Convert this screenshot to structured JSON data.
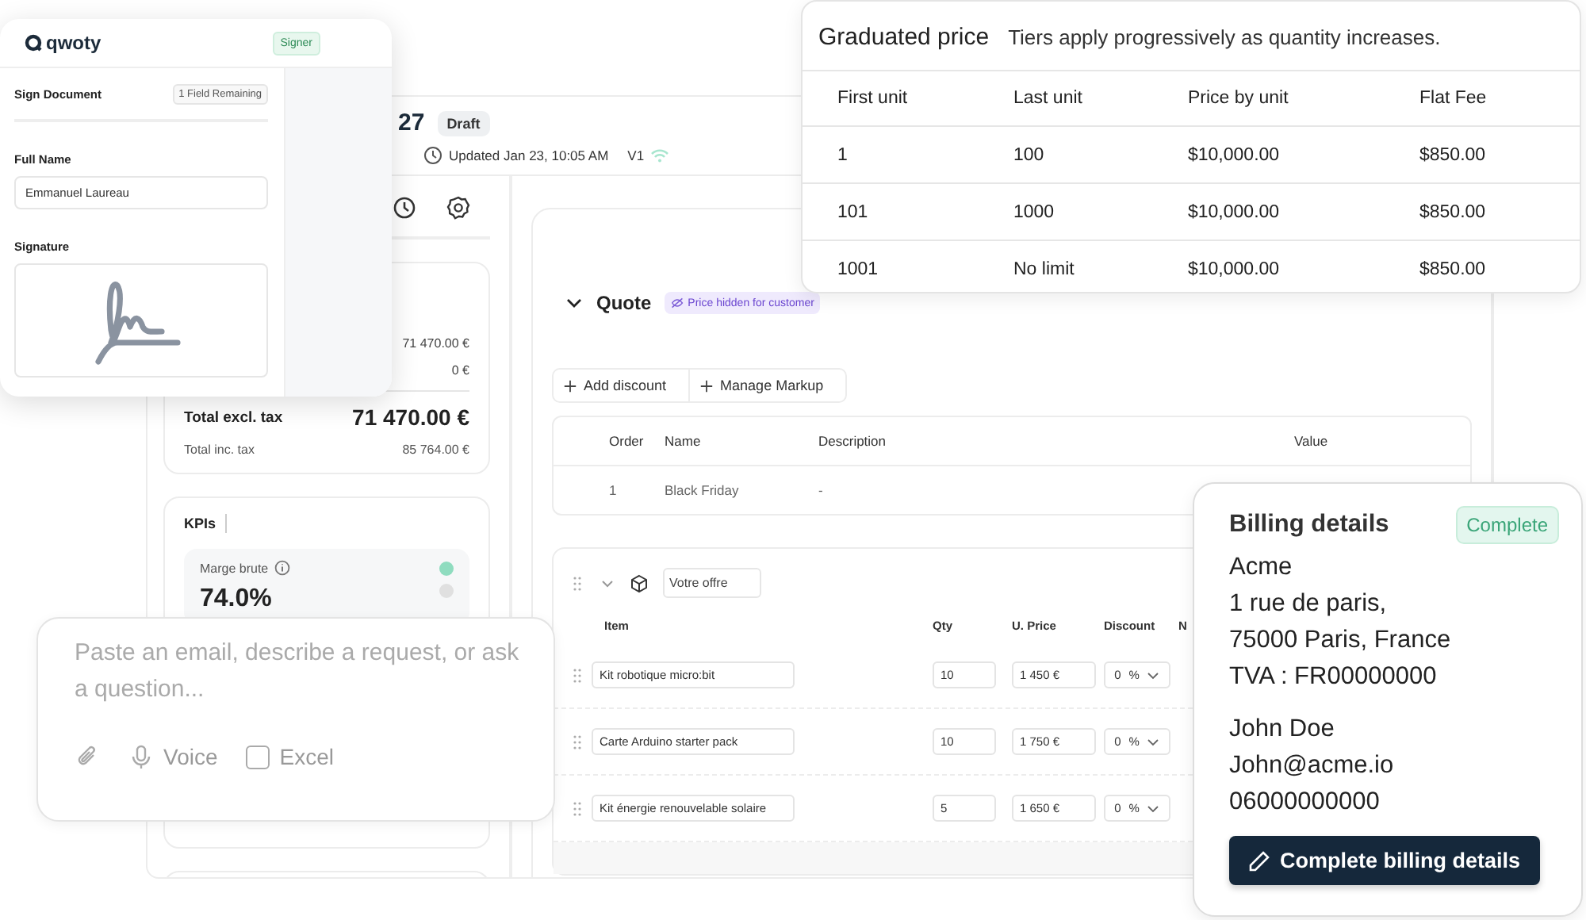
{
  "document": {
    "title": "27",
    "status": "Draft",
    "updated": "Updated Jan 23, 10:05 AM",
    "version": "V1"
  },
  "totals": {
    "rows": [
      {
        "value": "71 470.00 €"
      },
      {
        "value": "0 €"
      }
    ],
    "total_excl": {
      "label": "Total excl. tax",
      "value": "71 470.00 €"
    },
    "total_inc": {
      "label": "Total inc. tax",
      "value": "85 764.00 €"
    }
  },
  "kpis": {
    "title": "KPIs",
    "metric": {
      "label": "Marge brute",
      "value": "74.0%"
    },
    "pages": [
      {
        "selected": true
      },
      {
        "selected": false
      }
    ]
  },
  "quote": {
    "title": "Quote",
    "expanded": true,
    "badge": "Price hidden for customer",
    "actions": [
      "Add discount",
      "Manage Markup"
    ],
    "discounts": {
      "columns": [
        "Order",
        "Name",
        "Description",
        "Value"
      ],
      "rows": [
        [
          "1",
          "Black Friday",
          "-"
        ]
      ]
    },
    "offer": {
      "name": "Votre offre",
      "columns": [
        "Item",
        "Qty",
        "U. Price",
        "Discount",
        "N"
      ],
      "rows": [
        {
          "item": "Kit robotique micro:bit",
          "qty": "10",
          "price": "1 450 €",
          "discount": "0",
          "unit": "%"
        },
        {
          "item": "Carte Arduino starter pack",
          "qty": "10",
          "price": "1 750 €",
          "discount": "0",
          "unit": "%"
        },
        {
          "item": "Kit énergie renouvelable solaire",
          "qty": "5",
          "price": "1 650 €",
          "discount": "0",
          "unit": "%"
        }
      ]
    }
  },
  "sign": {
    "logo": "qwoty",
    "role": "Signer",
    "title": "Sign Document",
    "remaining": "1 Field Remaining",
    "name_label": "Full Name",
    "name_value": "Emmanuel Laureau",
    "signature_label": "Signature"
  },
  "graduated": {
    "title": "Graduated price",
    "subtitle": "Tiers apply progressively as quantity increases.",
    "columns": [
      "First unit",
      "Last unit",
      "Price by unit",
      "Flat Fee"
    ],
    "rows": [
      [
        "1",
        "100",
        "$10,000.00",
        "$850.00"
      ],
      [
        "101",
        "1000",
        "$10,000.00",
        "$850.00"
      ],
      [
        "1001",
        "No limit",
        "$10,000.00",
        "$850.00"
      ]
    ]
  },
  "prompt": {
    "placeholder": "Paste an email, describe a request, or ask a question...",
    "voice": "Voice",
    "excel": {
      "label": "Excel",
      "checked": false
    }
  },
  "billing": {
    "title": "Billing details",
    "status": "Complete",
    "address": [
      "Acme",
      "1 rue de paris,",
      "75000 Paris, France",
      "TVA : FR00000000"
    ],
    "contact": [
      "John Doe",
      "John@acme.io",
      "06000000000"
    ],
    "button": "Complete billing details"
  }
}
